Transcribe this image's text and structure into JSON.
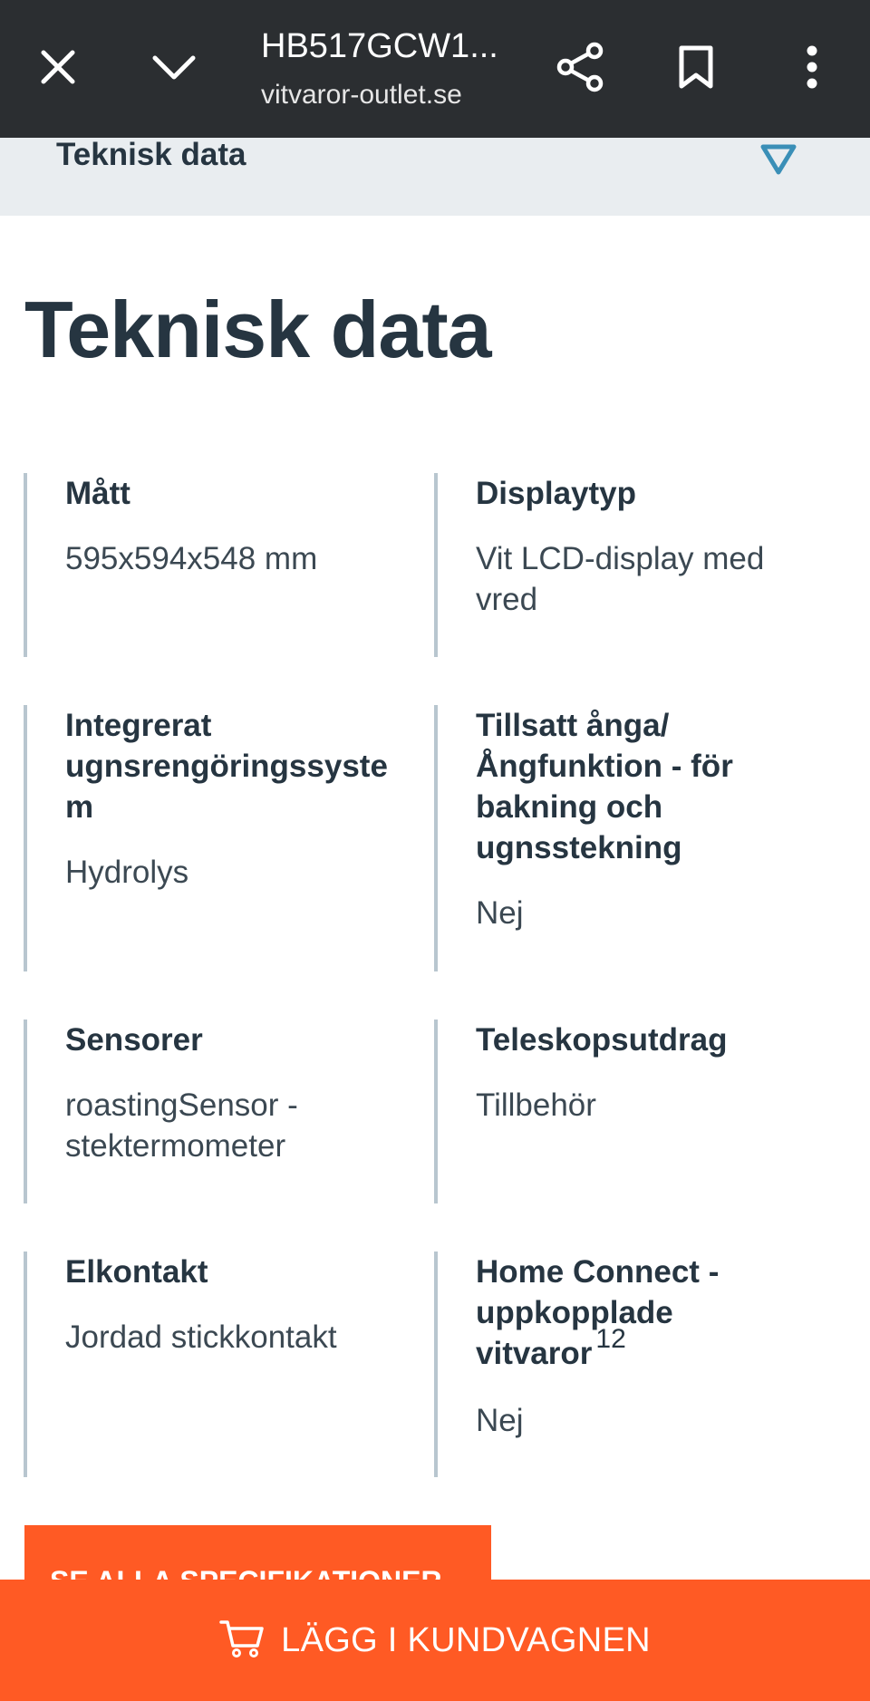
{
  "toolbar": {
    "title": "HB517GCW1...",
    "url": "vitvaror-outlet.se",
    "icons": [
      "close-icon",
      "chevron-down-icon",
      "share-icon",
      "bookmark-icon",
      "more-vertical-icon"
    ],
    "background": "#2b2e31"
  },
  "accordion": {
    "label": "Teknisk data",
    "icon": "triangle-down-icon",
    "icon_color": "#3a8fb7"
  },
  "page_title": "Teknisk data",
  "specs": [
    {
      "label": "Mått",
      "value": "595x594x548 mm"
    },
    {
      "label": "Displaytyp",
      "value": "Vit LCD-display med vred"
    },
    {
      "label": "Integrerat ugnsrengöringssyste m",
      "value": "Hydrolys"
    },
    {
      "label": "Tillsatt ånga/ Ångfunktion - för bakning och ugnsstekning",
      "value": "Nej"
    },
    {
      "label": "Sensorer",
      "value": "roastingSensor - stektermometer"
    },
    {
      "label": "Teleskopsutdrag",
      "value": "Tillbehör"
    },
    {
      "label": "Elkontakt",
      "value": "Jordad stickkontakt"
    },
    {
      "label": "Home Connect - uppkopplade vitvaror",
      "sup": "12",
      "value": "Nej"
    }
  ],
  "see_all_label": "SE ALLA SPECIFIKATIONER",
  "cart_label": "LÄGG I KUNDVAGNEN",
  "colors": {
    "accent": "#ff5a24",
    "text": "#263541",
    "divider": "#b8c6cf",
    "accordion_bg": "#e9edf0"
  }
}
